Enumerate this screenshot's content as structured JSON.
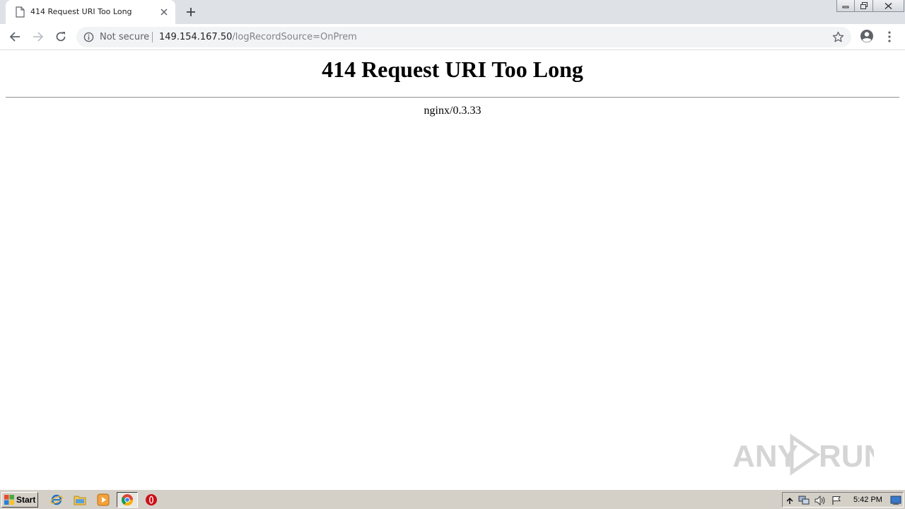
{
  "browser": {
    "tab": {
      "title": "414 Request URI Too Long"
    },
    "address_bar": {
      "security_label": "Not secure",
      "url_host": "149.154.167.50",
      "url_rest": "/logRecordSource=OnPrem"
    }
  },
  "page": {
    "heading": "414 Request URI Too Long",
    "server_signature": "nginx/0.3.33"
  },
  "taskbar": {
    "start_label": "Start",
    "clock": "5:42 PM"
  },
  "watermark": {
    "text": "ANY RUN"
  },
  "icons": {
    "tab_favicon": "page-icon",
    "tab_close": "close-icon",
    "new_tab": "plus-icon",
    "back": "arrow-left-icon",
    "forward": "arrow-right-icon",
    "reload": "reload-icon",
    "site_info": "info-icon",
    "bookmark": "star-icon",
    "profile": "profile-icon",
    "menu": "kebab-menu-icon"
  },
  "colors": {
    "tabstrip": "#dee1e6",
    "omnibox": "#f1f3f4",
    "taskbar": "#d4d0c8"
  }
}
